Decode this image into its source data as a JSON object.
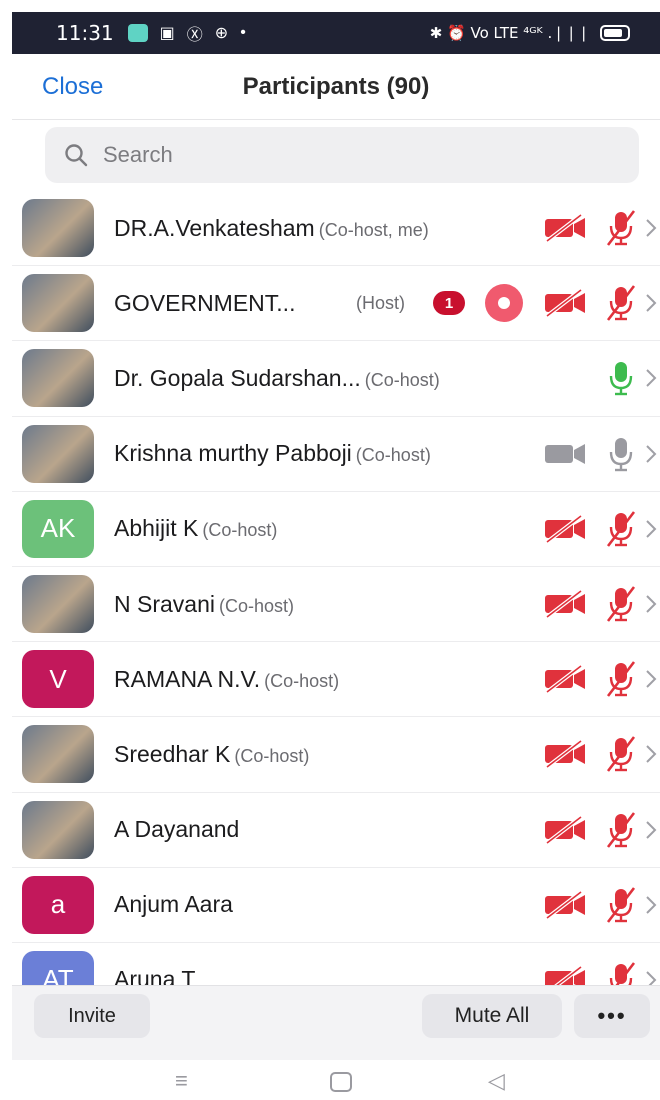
{
  "status_bar": {
    "time": "11:31",
    "left_icons": [
      "app-icon",
      "gallery-icon",
      "facebook-icon",
      "messenger-icon",
      "dot-icon"
    ],
    "right_text": "✱ ⏰ Vo LTE ⁴ᴳᴷ .❘❘❘"
  },
  "header": {
    "close_label": "Close",
    "title": "Participants (90)"
  },
  "search": {
    "placeholder": "Search"
  },
  "colors": {
    "accent": "#1c6fd6",
    "muted_red": "#e0323c",
    "mic_green": "#3dbb4e",
    "neutral_gray": "#9a9aa0"
  },
  "participants": [
    {
      "name": "DR.A.Venkatesham",
      "role": "(Co-host, me)",
      "avatar": "photo",
      "camera": "off",
      "mic": "muted"
    },
    {
      "name": "GOVERNMENT...",
      "role": "(Host)",
      "avatar": "photo",
      "unread": "1",
      "recording": true,
      "camera": "off",
      "mic": "muted"
    },
    {
      "name": "Dr. Gopala Sudarshan...",
      "role": "(Co-host)",
      "avatar": "photo",
      "camera": "none",
      "mic": "active"
    },
    {
      "name": "Krishna murthy Pabboji",
      "role": "(Co-host)",
      "avatar": "photo",
      "camera": "on",
      "mic": "on"
    },
    {
      "name": "Abhijit K",
      "role": "(Co-host)",
      "avatar": "AK",
      "avatar_color": "#6cc17a",
      "camera": "off",
      "mic": "muted"
    },
    {
      "name": "N Sravani",
      "role": "(Co-host)",
      "avatar": "photo",
      "camera": "off",
      "mic": "muted"
    },
    {
      "name": "RAMANA N.V.",
      "role": "(Co-host)",
      "avatar": "V",
      "avatar_color": "#c2185b",
      "camera": "off",
      "mic": "muted"
    },
    {
      "name": "Sreedhar K",
      "role": "(Co-host)",
      "avatar": "photo",
      "camera": "off",
      "mic": "muted"
    },
    {
      "name": "A Dayanand",
      "role": "",
      "avatar": "photo",
      "camera": "off",
      "mic": "muted"
    },
    {
      "name": "Anjum Aara",
      "role": "",
      "avatar": "a",
      "avatar_color": "#c2185b",
      "camera": "off",
      "mic": "muted"
    },
    {
      "name": "Aruna T",
      "role": "",
      "avatar": "AT",
      "avatar_color": "#6b7fd7",
      "camera": "off",
      "mic": "muted"
    }
  ],
  "footer": {
    "invite_label": "Invite",
    "mute_all_label": "Mute All",
    "more_label": "•••"
  },
  "nav": {
    "menu_glyph": "≡",
    "back_glyph": "◁"
  }
}
